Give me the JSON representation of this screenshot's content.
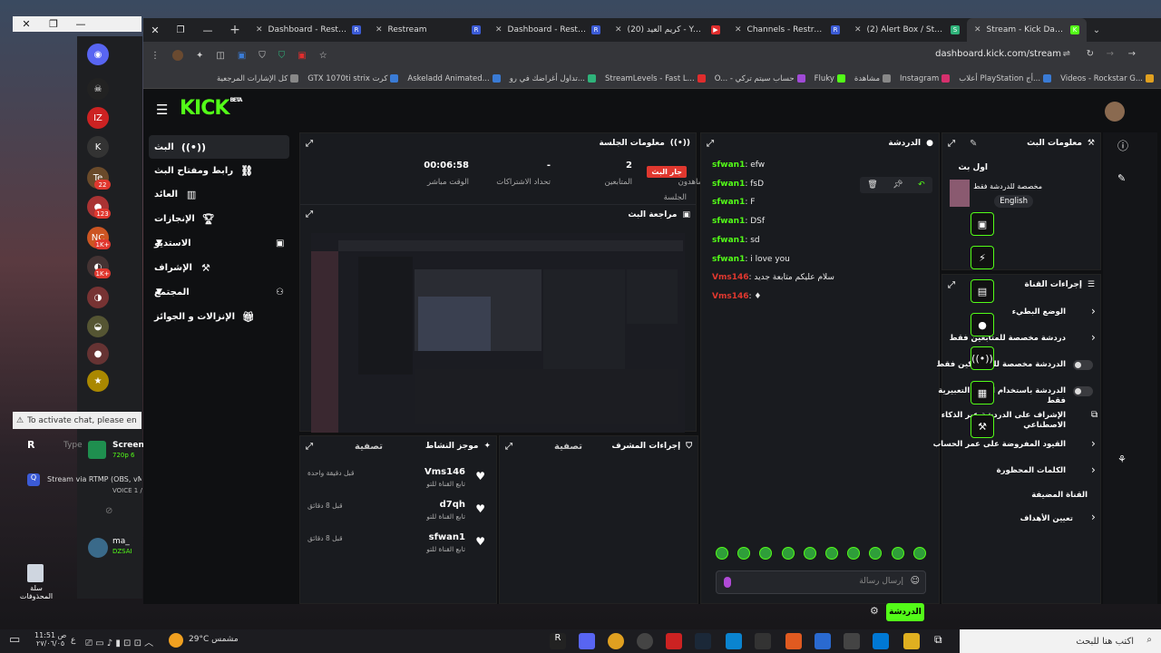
{
  "outer_window": {
    "close": "✕",
    "restore": "❐",
    "minimize": "—"
  },
  "tabs": [
    {
      "label": "Dashboard - Restream",
      "icon_color": "#3b5bd6",
      "icon": "R"
    },
    {
      "label": "Restream",
      "icon_color": "#3b5bd6",
      "icon": "R"
    },
    {
      "label": "Dashboard - Restream",
      "icon_color": "#3b5bd6",
      "icon": "R"
    },
    {
      "label": "كريم العيد (20) - YouTube",
      "icon_color": "#e02d2d",
      "icon": "▶"
    },
    {
      "label": "Channels - Restream",
      "icon_color": "#3b5bd6",
      "icon": "R"
    },
    {
      "label": "(2) Alert Box / Streamlabs",
      "icon_color": "#2fb37a",
      "icon": "S"
    },
    {
      "label": "Stream - Kick Dashboard",
      "icon_color": "#53fc18",
      "icon": "K"
    }
  ],
  "address": {
    "url": "dashboard.kick.com/stream"
  },
  "bookmarks": [
    {
      "label": "كل الإشارات المرجعية",
      "color": "#888"
    },
    {
      "label": "GTX 1070ti strix كرت",
      "color": "#3a7bd5"
    },
    {
      "label": "Askeladd Animated...",
      "color": "#3a7bd5"
    },
    {
      "label": "تداول أغراضك في رو...",
      "color": "#2fb37a"
    },
    {
      "label": "StreamLevels - Fast L...",
      "color": "#e02d2d"
    },
    {
      "label": "O... - حساب سيتم تركي",
      "color": "#a04ad6"
    },
    {
      "label": "Fluky",
      "color": "#53fc18"
    },
    {
      "label": "مشاهدة",
      "color": "#888"
    },
    {
      "label": "Instagram",
      "color": "#d6306d"
    },
    {
      "label": "أعلاب PlayStation أج...",
      "color": "#3a7bd5"
    },
    {
      "label": "Videos - Rockstar G...",
      "color": "#e0a020"
    }
  ],
  "nav": {
    "live": "البث",
    "stream_key": "رابط ومفتاح البث",
    "earnings": "العائد",
    "achievements": "الإنجازات",
    "studio": "الاستديو",
    "moderation": "الإشراف",
    "community": "المجتمع",
    "drops": "الإنزالات و الجوائز"
  },
  "session": {
    "title": "معلومات الجلسة",
    "stats": [
      {
        "value": "00:06:58",
        "label": "الوقت مباشر"
      },
      {
        "value": "-",
        "label": "تحداد الاشتراكات"
      },
      {
        "value": "2",
        "label": "المتابعين"
      },
      {
        "value": "6",
        "label": "المشاهدون"
      }
    ],
    "live_badge": "جار البث",
    "live_sub": "الجلسة"
  },
  "preview": {
    "title": "مراجعة البث"
  },
  "activity": {
    "title": "موجز النشاط",
    "filter": "تصفية",
    "items": [
      {
        "name": "Vms146",
        "sub": "تابع القناة للتو",
        "time": "قبل دقيقة واحدة"
      },
      {
        "name": "d7qh",
        "sub": "تابع القناة للتو",
        "time": "قبل 8 دقائق"
      },
      {
        "name": "sfwan1",
        "sub": "تابع القناة للتو",
        "time": "قبل 8 دقائق"
      }
    ]
  },
  "mod_actions": {
    "title": "إجراءات المشرف",
    "filter": "تصفية"
  },
  "chat": {
    "title": "الدردشة",
    "messages": [
      {
        "user": "sfwan1",
        "text": ": efw",
        "red": false
      },
      {
        "user": "sfwan1",
        "text": ": fsD",
        "red": false
      },
      {
        "user": "sfwan1",
        "text": ": F",
        "red": false
      },
      {
        "user": "sfwan1",
        "text": ": DSf",
        "red": false
      },
      {
        "user": "sfwan1",
        "text": ": sd",
        "red": false
      },
      {
        "user": "sfwan1",
        "text": ": i love you",
        "red": false
      },
      {
        "user": "Vms146",
        "text": ": سلام عليكم متابعة جديد",
        "red": true
      },
      {
        "user": "Vms146",
        "text": ": ♦",
        "red": true
      }
    ],
    "placeholder": "إرسال رسالة",
    "send": "الدردشة"
  },
  "stream_info": {
    "title": "معلومات البث",
    "stream_title": "اول بث",
    "category": "مخصصة للدردشة فقط",
    "language": "English"
  },
  "channel_actions": {
    "title": "إجراءات القناة",
    "items": [
      {
        "label": "الوضع البطيء",
        "control": "arrow"
      },
      {
        "label": "دردشة مخصصة للمتابعين فقط",
        "control": "arrow"
      },
      {
        "label": "الدردشة مخصصة للمشتركين فقط",
        "control": "toggle"
      },
      {
        "label": "الدردشة باستخدام الصور التعبيرية فقط",
        "control": "toggle"
      },
      {
        "label": "الإشراف على الدردشة عبر الذكاء الاصطناعي",
        "control": "external"
      },
      {
        "label": "القيود المفروضة على عمر الحساب",
        "control": "arrow"
      },
      {
        "label": "الكلمات المحظورة",
        "control": "arrow"
      }
    ],
    "section": "القناة المضيفة",
    "goals": "تعيين الأهداف"
  },
  "desktop": {
    "tooltip": "To activate chat, please en",
    "screen_label": "Screen",
    "screen_sub": "720p 6",
    "restream_label": "Stream via RTMP (OBS, vMix",
    "restream_sub": "VOICE 1 /",
    "user_label": "ma_",
    "user_sub": "DZSAI",
    "trash_label": "سلة المحذوفات",
    "type_hint": "Type"
  },
  "taskbar": {
    "time": "11:51 ص",
    "date": "٢٧/٠٦/٠٥",
    "weather": "29°C مشمس",
    "search": "اكتب هنا للبحث"
  }
}
